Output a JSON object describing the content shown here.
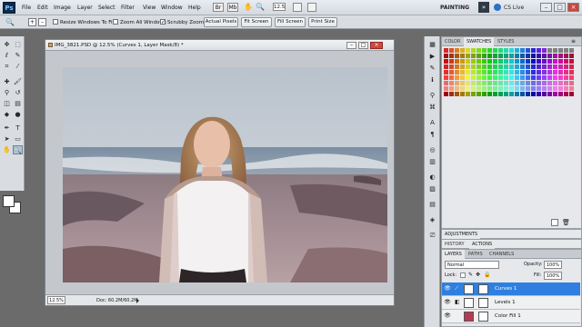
{
  "menubar": {
    "app_icon": "Ps",
    "items": [
      "File",
      "Edit",
      "Image",
      "Layer",
      "Select",
      "Filter",
      "View",
      "Window",
      "Help"
    ],
    "zoom_value": "12.5",
    "workspace": "PAINTING",
    "cslive": "CS Live"
  },
  "options": {
    "resize_windows": "Resize Windows To Fit",
    "zoom_all": "Zoom All Windows",
    "scrubby_zoom": "Scrubby Zoom",
    "actual_pixels": "Actual Pixels",
    "fit_screen": "Fit Screen",
    "fill_screen": "Fill Screen",
    "print_size": "Print Size"
  },
  "document": {
    "title": "IMG_3821.PSD @ 12.5% (Curves 1, Layer Mask/8) *",
    "zoom": "12.5%",
    "doc_info": "Doc: 60.2M/60.2M"
  },
  "colors_panel": {
    "tabs": [
      "COLOR",
      "SWATCHES",
      "STYLES"
    ],
    "active_tab": "SWATCHES"
  },
  "adjustments_panel": {
    "title": "ADJUSTMENTS"
  },
  "history_panel": {
    "tabs": [
      "HISTORY",
      "ACTIONS"
    ],
    "active_tab": "ACTIONS"
  },
  "layers_panel": {
    "tabs": [
      "LAYERS",
      "PATHS",
      "CHANNELS"
    ],
    "active_tab": "LAYERS",
    "blend_mode": "Normal",
    "opacity_label": "Opacity:",
    "opacity_value": "100%",
    "lock_label": "Lock:",
    "fill_label": "Fill:",
    "fill_value": "100%",
    "layers": [
      {
        "name": "Curves 1",
        "selected": true
      },
      {
        "name": "Levels 1",
        "selected": false
      },
      {
        "name": "Color Fill 1",
        "selected": false
      }
    ]
  },
  "accent_color": "#2f7fe0"
}
